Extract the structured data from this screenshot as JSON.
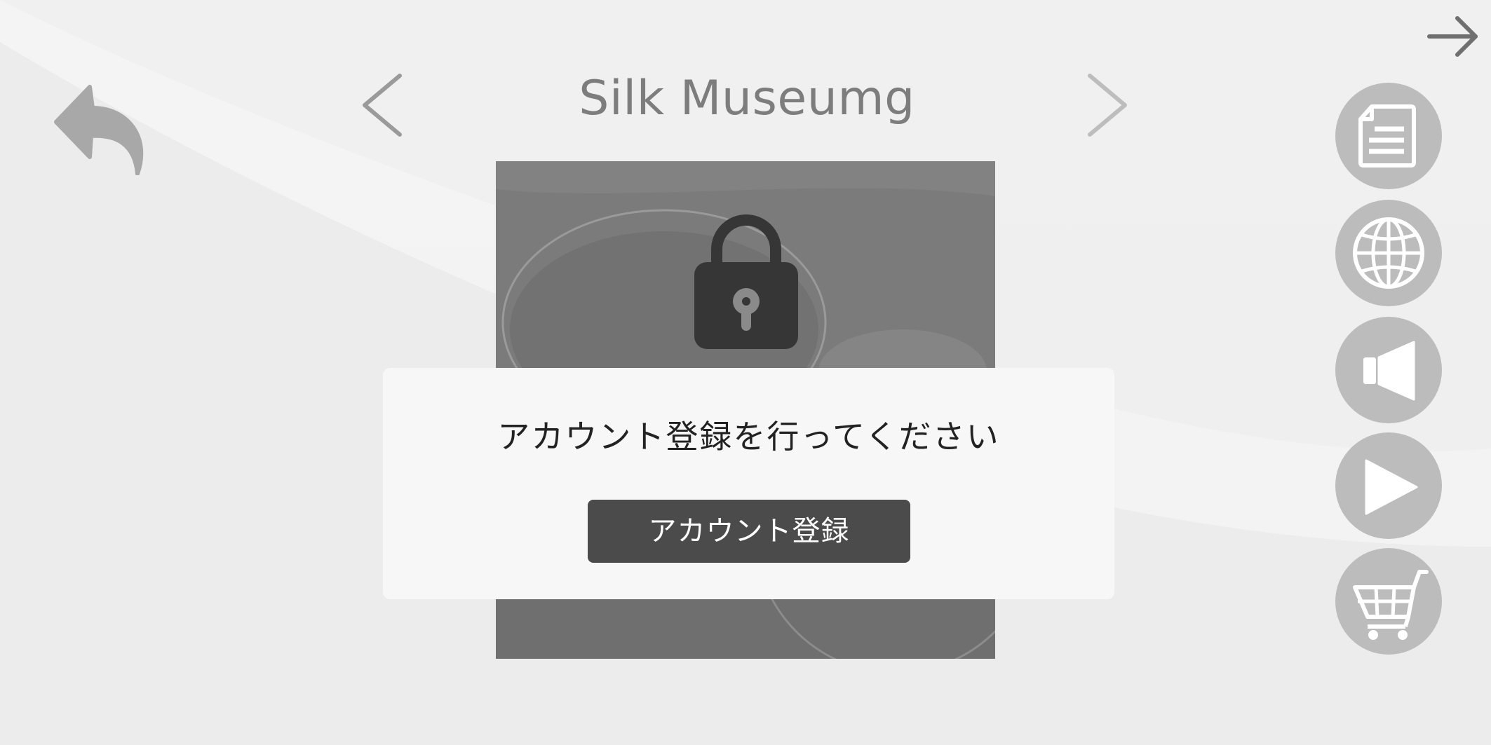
{
  "header": {
    "title": "Silk Museumg"
  },
  "modal": {
    "message": "アカウント登録を行ってください",
    "register_button_label": "アカウント登録"
  },
  "icons": {
    "exit": "arrow-right-icon",
    "back": "back-arrow-icon",
    "prev": "chevron-left-icon",
    "next": "chevron-right-icon",
    "lock": "lock-icon",
    "document": "document-icon",
    "language": "globe-icon",
    "audio": "speaker-icon",
    "play": "play-icon",
    "cart": "cart-icon"
  },
  "colors": {
    "background": "#efefef",
    "side_button": "#bcbcbc",
    "button_dark": "#4b4b4b",
    "title": "#7d7d7d"
  }
}
